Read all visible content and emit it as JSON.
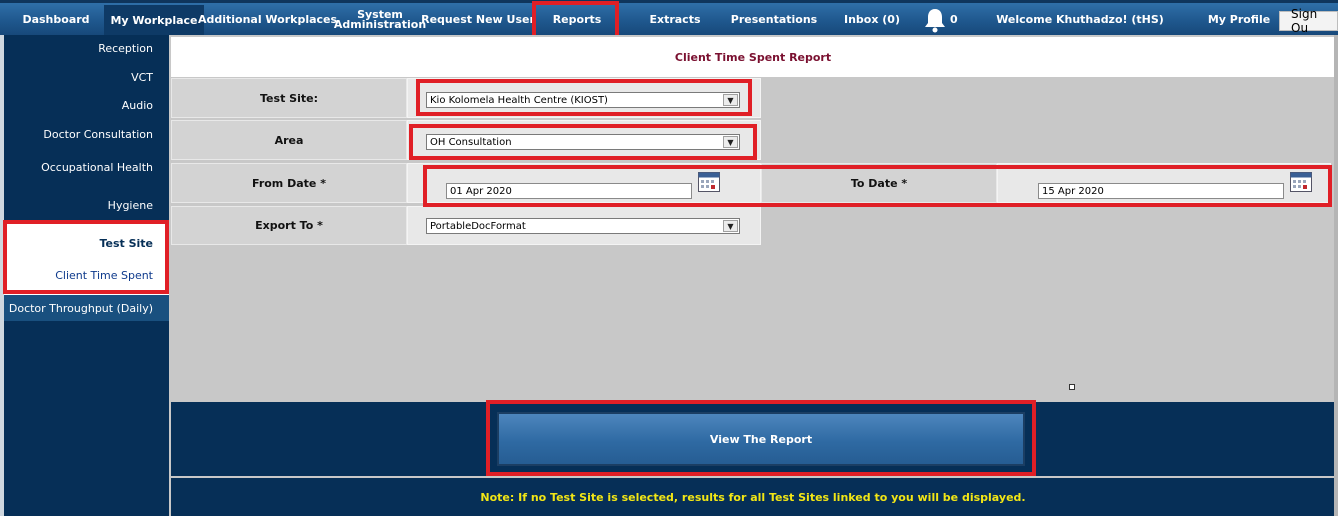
{
  "nav": {
    "items": [
      {
        "label": "Dashboard"
      },
      {
        "label": "My Workplace",
        "active": true
      },
      {
        "label": "Additional Workplaces"
      },
      {
        "label": "System Administration"
      },
      {
        "label": "Request New User"
      },
      {
        "label": "Reports"
      },
      {
        "label": "Extracts"
      },
      {
        "label": "Presentations"
      },
      {
        "label": "Inbox (0)"
      },
      {
        "label": "Welcome Khuthadzo! (tHS)"
      },
      {
        "label": "My Profile"
      }
    ],
    "system_line1": "System",
    "system_line2": "Administration",
    "bell_count": "0",
    "bell_icon": "bell-icon",
    "signout_label": "Sign Ou"
  },
  "sidebar": {
    "items": [
      "Reception",
      "VCT",
      "Audio",
      "Doctor Consultation",
      "Occupational Health",
      "Hygiene"
    ],
    "section_header": "Test Site",
    "section_sub": "Client Time Spent",
    "throughput": "Doctor Throughput (Daily)"
  },
  "report": {
    "title": "Client Time Spent Report",
    "test_site_label": "Test Site:",
    "test_site_value": "Kio Kolomela Health Centre (KIOST)",
    "area_label": "Area",
    "area_value": "OH Consultation",
    "from_date_label": "From Date *",
    "from_date_value": "01 Apr 2020",
    "to_date_label": "To Date *",
    "to_date_value": "15 Apr 2020",
    "export_label": "Export To *",
    "export_value": "PortableDocFormat",
    "view_button": "View The Report",
    "note": "Note: If no Test Site is selected, results for all Test Sites linked to you will be displayed."
  },
  "colors": {
    "nav_blue": "#1e568c",
    "sidebar_navy": "#062f57",
    "highlight_red": "#e01f26",
    "note_yellow": "#f2e615",
    "title_maroon": "#7a1030"
  }
}
